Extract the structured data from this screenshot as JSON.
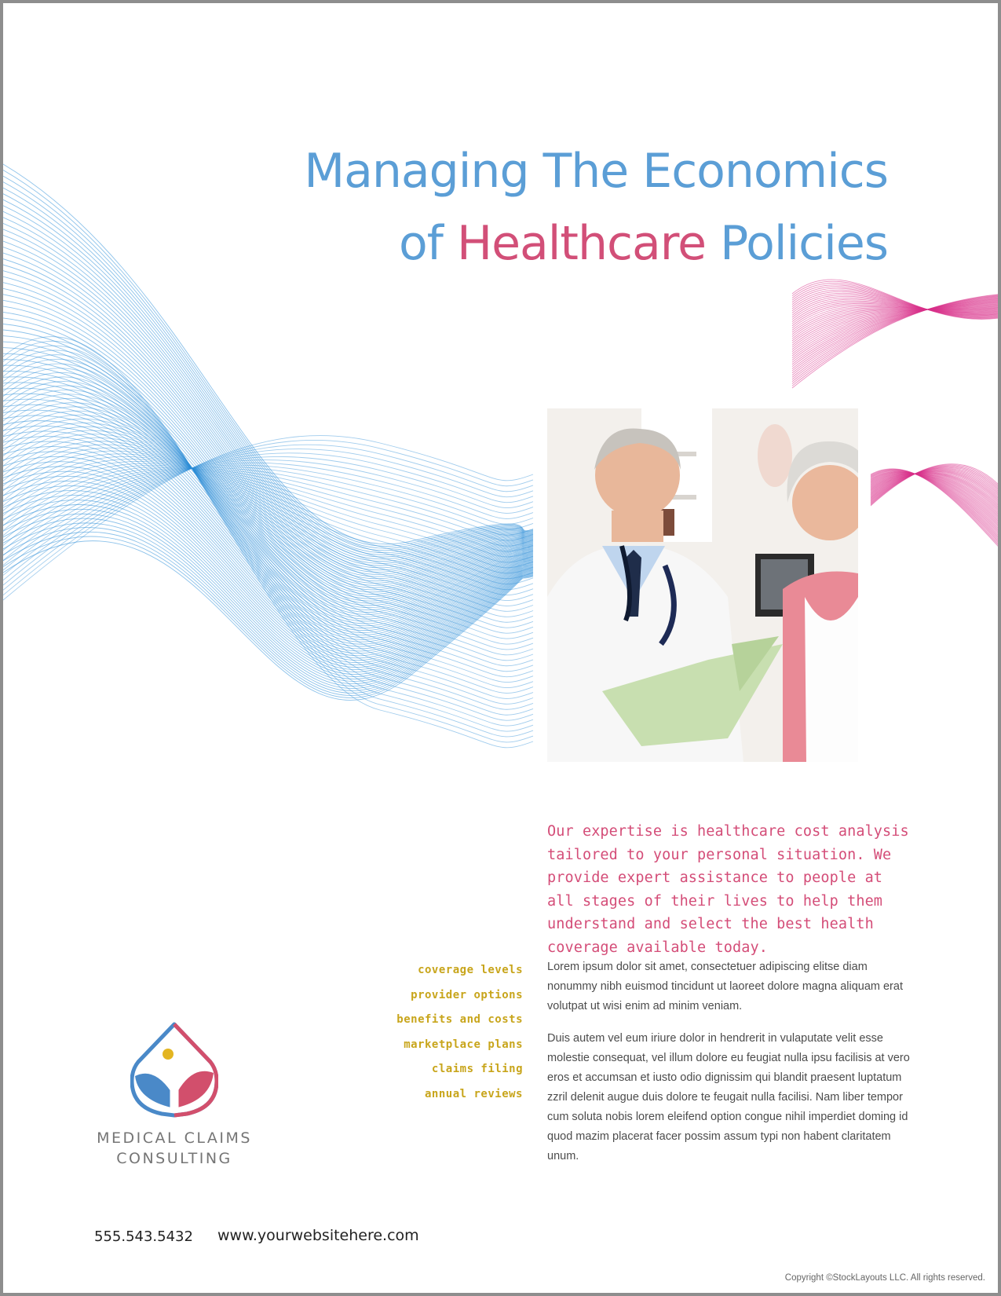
{
  "headline": {
    "part1": "Managing The Economics",
    "part2a": "of ",
    "part2b": "Healthcare",
    "part2c": " Policies"
  },
  "photo": {
    "subject": "doctor-and-senior-patient-photo"
  },
  "intro": "Our expertise is healthcare cost analysis tailored to your personal situation. We provide expert assistance to people at all stages of their lives to help them understand and select the best health coverage available today.",
  "topics": [
    "coverage levels",
    "provider options",
    "benefits and costs",
    "marketplace plans",
    "claims filing",
    "annual reviews"
  ],
  "body": {
    "p1": "Lorem ipsum dolor sit amet, consectetuer adipiscing elitse diam nonummy nibh euismod tincidunt ut laoreet dolore magna aliquam erat volutpat ut wisi enim ad minim veniam.",
    "p2": "Duis autem vel eum iriure dolor in hendrerit in vulaputate velit esse molestie consequat, vel illum dolore eu feugiat nulla ipsu facilisis at vero eros et accumsan et iusto odio dignissim qui blandit praesent luptatum zzril delenit augue duis dolore te feugait nulla facilisi. Nam liber tempor cum soluta nobis lorem eleifend option congue nihil imperdiet doming id quod mazim placerat facer possim assum typi non habent claritatem unum."
  },
  "logo": {
    "line1": "MEDICAL CLAIMS",
    "line2": "CONSULTING",
    "icon": "leaf-drop-icon"
  },
  "contact": {
    "phone": "555.543.5432",
    "website": "www.yourwebsitehere.com"
  },
  "copyright": "Copyright ©StockLayouts LLC. All rights reserved.",
  "colors": {
    "blue": "#5b9ed6",
    "wave_blue": "#2f8fd8",
    "pink": "#d44d78",
    "wave_pink": "#d9318b",
    "gold": "#c8a51b",
    "text": "#4c4c4c",
    "border": "#8e8e8e"
  }
}
